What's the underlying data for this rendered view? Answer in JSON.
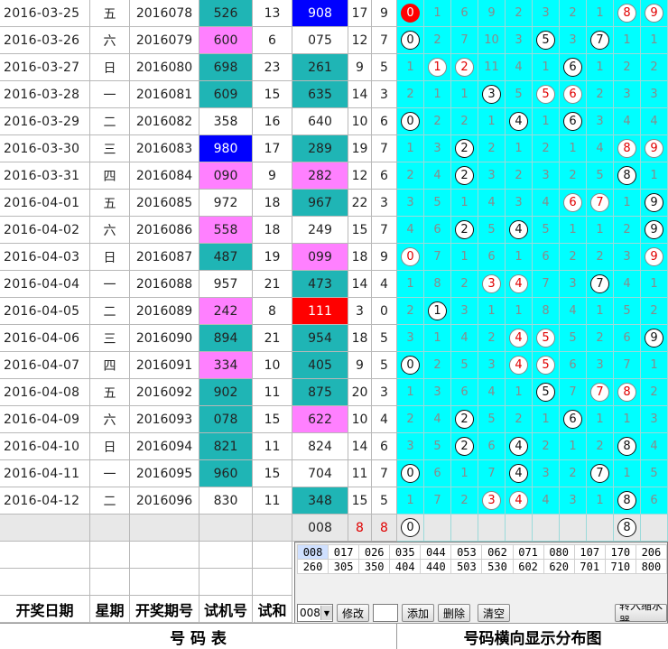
{
  "table": {
    "rows": [
      {
        "date": "2016-03-25",
        "week": "五",
        "issue": "2016078",
        "trial": "526",
        "trial_color": "teal",
        "sum1": "13",
        "draw": "908",
        "draw_color": "blue",
        "sum2": "17",
        "span": "9",
        "dist": [
          {
            "v": "0",
            "s": "fill"
          },
          {
            "v": "1"
          },
          {
            "v": "6"
          },
          {
            "v": "9"
          },
          {
            "v": "2"
          },
          {
            "v": "3"
          },
          {
            "v": "2"
          },
          {
            "v": "1"
          },
          {
            "v": "8",
            "s": "red"
          },
          {
            "v": "9",
            "s": "red"
          }
        ]
      },
      {
        "date": "2016-03-26",
        "week": "六",
        "issue": "2016079",
        "trial": "600",
        "trial_color": "pink",
        "sum1": "6",
        "draw": "075",
        "draw_color": "",
        "sum2": "12",
        "span": "7",
        "dist": [
          {
            "v": "0",
            "s": "c"
          },
          {
            "v": "2"
          },
          {
            "v": "7"
          },
          {
            "v": "10"
          },
          {
            "v": "3"
          },
          {
            "v": "5",
            "s": "c"
          },
          {
            "v": "3"
          },
          {
            "v": "7",
            "s": "c"
          },
          {
            "v": "1"
          },
          {
            "v": "1"
          }
        ]
      },
      {
        "date": "2016-03-27",
        "week": "日",
        "issue": "2016080",
        "trial": "698",
        "trial_color": "teal",
        "sum1": "23",
        "draw": "261",
        "draw_color": "teal",
        "sum2": "9",
        "span": "5",
        "dist": [
          {
            "v": "1"
          },
          {
            "v": "1",
            "s": "red"
          },
          {
            "v": "2",
            "s": "red"
          },
          {
            "v": "11"
          },
          {
            "v": "4"
          },
          {
            "v": "1"
          },
          {
            "v": "6",
            "s": "c"
          },
          {
            "v": "1"
          },
          {
            "v": "2"
          },
          {
            "v": "2"
          }
        ]
      },
      {
        "date": "2016-03-28",
        "week": "一",
        "issue": "2016081",
        "trial": "609",
        "trial_color": "teal",
        "sum1": "15",
        "draw": "635",
        "draw_color": "teal",
        "sum2": "14",
        "span": "3",
        "dist": [
          {
            "v": "2"
          },
          {
            "v": "1"
          },
          {
            "v": "1"
          },
          {
            "v": "3",
            "s": "c"
          },
          {
            "v": "5"
          },
          {
            "v": "5",
            "s": "red"
          },
          {
            "v": "6",
            "s": "red"
          },
          {
            "v": "2"
          },
          {
            "v": "3"
          },
          {
            "v": "3"
          }
        ]
      },
      {
        "date": "2016-03-29",
        "week": "二",
        "issue": "2016082",
        "trial": "358",
        "trial_color": "",
        "sum1": "16",
        "draw": "640",
        "draw_color": "",
        "sum2": "10",
        "span": "6",
        "dist": [
          {
            "v": "0",
            "s": "c"
          },
          {
            "v": "2"
          },
          {
            "v": "2"
          },
          {
            "v": "1"
          },
          {
            "v": "4",
            "s": "c"
          },
          {
            "v": "1"
          },
          {
            "v": "6",
            "s": "c"
          },
          {
            "v": "3"
          },
          {
            "v": "4"
          },
          {
            "v": "4"
          }
        ]
      },
      {
        "date": "2016-03-30",
        "week": "三",
        "issue": "2016083",
        "trial": "980",
        "trial_color": "blue",
        "sum1": "17",
        "draw": "289",
        "draw_color": "teal",
        "sum2": "19",
        "span": "7",
        "dist": [
          {
            "v": "1"
          },
          {
            "v": "3"
          },
          {
            "v": "2",
            "s": "c"
          },
          {
            "v": "2"
          },
          {
            "v": "1"
          },
          {
            "v": "2"
          },
          {
            "v": "1"
          },
          {
            "v": "4"
          },
          {
            "v": "8",
            "s": "red"
          },
          {
            "v": "9",
            "s": "red"
          }
        ]
      },
      {
        "date": "2016-03-31",
        "week": "四",
        "issue": "2016084",
        "trial": "090",
        "trial_color": "pink",
        "sum1": "9",
        "draw": "282",
        "draw_color": "pink",
        "sum2": "12",
        "span": "6",
        "dist": [
          {
            "v": "2"
          },
          {
            "v": "4"
          },
          {
            "v": "2",
            "s": "c"
          },
          {
            "v": "3"
          },
          {
            "v": "2"
          },
          {
            "v": "3"
          },
          {
            "v": "2"
          },
          {
            "v": "5"
          },
          {
            "v": "8",
            "s": "c"
          },
          {
            "v": "1"
          }
        ]
      },
      {
        "date": "2016-04-01",
        "week": "五",
        "issue": "2016085",
        "trial": "972",
        "trial_color": "",
        "sum1": "18",
        "draw": "967",
        "draw_color": "teal",
        "sum2": "22",
        "span": "3",
        "dist": [
          {
            "v": "3"
          },
          {
            "v": "5"
          },
          {
            "v": "1"
          },
          {
            "v": "4"
          },
          {
            "v": "3"
          },
          {
            "v": "4"
          },
          {
            "v": "6",
            "s": "red"
          },
          {
            "v": "7",
            "s": "red"
          },
          {
            "v": "1"
          },
          {
            "v": "9",
            "s": "c"
          }
        ]
      },
      {
        "date": "2016-04-02",
        "week": "六",
        "issue": "2016086",
        "trial": "558",
        "trial_color": "pink",
        "sum1": "18",
        "draw": "249",
        "draw_color": "",
        "sum2": "15",
        "span": "7",
        "dist": [
          {
            "v": "4"
          },
          {
            "v": "6"
          },
          {
            "v": "2",
            "s": "c"
          },
          {
            "v": "5"
          },
          {
            "v": "4",
            "s": "c"
          },
          {
            "v": "5"
          },
          {
            "v": "1"
          },
          {
            "v": "1"
          },
          {
            "v": "2"
          },
          {
            "v": "9",
            "s": "c"
          }
        ]
      },
      {
        "date": "2016-04-03",
        "week": "日",
        "issue": "2016087",
        "trial": "487",
        "trial_color": "teal",
        "sum1": "19",
        "draw": "099",
        "draw_color": "pink",
        "sum2": "18",
        "span": "9",
        "dist": [
          {
            "v": "0",
            "s": "red"
          },
          {
            "v": "7"
          },
          {
            "v": "1"
          },
          {
            "v": "6"
          },
          {
            "v": "1"
          },
          {
            "v": "6"
          },
          {
            "v": "2"
          },
          {
            "v": "2"
          },
          {
            "v": "3"
          },
          {
            "v": "9",
            "s": "red"
          }
        ]
      },
      {
        "date": "2016-04-04",
        "week": "一",
        "issue": "2016088",
        "trial": "957",
        "trial_color": "",
        "sum1": "21",
        "draw": "473",
        "draw_color": "teal",
        "sum2": "14",
        "span": "4",
        "dist": [
          {
            "v": "1"
          },
          {
            "v": "8"
          },
          {
            "v": "2"
          },
          {
            "v": "3",
            "s": "red"
          },
          {
            "v": "4",
            "s": "red"
          },
          {
            "v": "7"
          },
          {
            "v": "3"
          },
          {
            "v": "7",
            "s": "c"
          },
          {
            "v": "4"
          },
          {
            "v": "1"
          }
        ]
      },
      {
        "date": "2016-04-05",
        "week": "二",
        "issue": "2016089",
        "trial": "242",
        "trial_color": "pink",
        "sum1": "8",
        "draw": "111",
        "draw_color": "red",
        "sum2": "3",
        "span": "0",
        "dist": [
          {
            "v": "2"
          },
          {
            "v": "1",
            "s": "c"
          },
          {
            "v": "3"
          },
          {
            "v": "1"
          },
          {
            "v": "1"
          },
          {
            "v": "8"
          },
          {
            "v": "4"
          },
          {
            "v": "1"
          },
          {
            "v": "5"
          },
          {
            "v": "2"
          }
        ]
      },
      {
        "date": "2016-04-06",
        "week": "三",
        "issue": "2016090",
        "trial": "894",
        "trial_color": "teal",
        "sum1": "21",
        "draw": "954",
        "draw_color": "teal",
        "sum2": "18",
        "span": "5",
        "dist": [
          {
            "v": "3"
          },
          {
            "v": "1"
          },
          {
            "v": "4"
          },
          {
            "v": "2"
          },
          {
            "v": "4",
            "s": "red"
          },
          {
            "v": "5",
            "s": "red"
          },
          {
            "v": "5"
          },
          {
            "v": "2"
          },
          {
            "v": "6"
          },
          {
            "v": "9",
            "s": "c"
          }
        ]
      },
      {
        "date": "2016-04-07",
        "week": "四",
        "issue": "2016091",
        "trial": "334",
        "trial_color": "pink",
        "sum1": "10",
        "draw": "405",
        "draw_color": "teal",
        "sum2": "9",
        "span": "5",
        "dist": [
          {
            "v": "0",
            "s": "c"
          },
          {
            "v": "2"
          },
          {
            "v": "5"
          },
          {
            "v": "3"
          },
          {
            "v": "4",
            "s": "red"
          },
          {
            "v": "5",
            "s": "red"
          },
          {
            "v": "6"
          },
          {
            "v": "3"
          },
          {
            "v": "7"
          },
          {
            "v": "1"
          }
        ]
      },
      {
        "date": "2016-04-08",
        "week": "五",
        "issue": "2016092",
        "trial": "902",
        "trial_color": "teal",
        "sum1": "11",
        "draw": "875",
        "draw_color": "teal",
        "sum2": "20",
        "span": "3",
        "dist": [
          {
            "v": "1"
          },
          {
            "v": "3"
          },
          {
            "v": "6"
          },
          {
            "v": "4"
          },
          {
            "v": "1"
          },
          {
            "v": "5",
            "s": "c"
          },
          {
            "v": "7"
          },
          {
            "v": "7",
            "s": "red"
          },
          {
            "v": "8",
            "s": "red"
          },
          {
            "v": "2"
          }
        ]
      },
      {
        "date": "2016-04-09",
        "week": "六",
        "issue": "2016093",
        "trial": "078",
        "trial_color": "teal",
        "sum1": "15",
        "draw": "622",
        "draw_color": "pink",
        "sum2": "10",
        "span": "4",
        "dist": [
          {
            "v": "2"
          },
          {
            "v": "4"
          },
          {
            "v": "2",
            "s": "c"
          },
          {
            "v": "5"
          },
          {
            "v": "2"
          },
          {
            "v": "1"
          },
          {
            "v": "6",
            "s": "c"
          },
          {
            "v": "1"
          },
          {
            "v": "1"
          },
          {
            "v": "3"
          }
        ]
      },
      {
        "date": "2016-04-10",
        "week": "日",
        "issue": "2016094",
        "trial": "821",
        "trial_color": "teal",
        "sum1": "11",
        "draw": "824",
        "draw_color": "",
        "sum2": "14",
        "span": "6",
        "dist": [
          {
            "v": "3"
          },
          {
            "v": "5"
          },
          {
            "v": "2",
            "s": "c"
          },
          {
            "v": "6"
          },
          {
            "v": "4",
            "s": "c"
          },
          {
            "v": "2"
          },
          {
            "v": "1"
          },
          {
            "v": "2"
          },
          {
            "v": "8",
            "s": "c"
          },
          {
            "v": "4"
          }
        ]
      },
      {
        "date": "2016-04-11",
        "week": "一",
        "issue": "2016095",
        "trial": "960",
        "trial_color": "teal",
        "sum1": "15",
        "draw": "704",
        "draw_color": "",
        "sum2": "11",
        "span": "7",
        "dist": [
          {
            "v": "0",
            "s": "c"
          },
          {
            "v": "6"
          },
          {
            "v": "1"
          },
          {
            "v": "7"
          },
          {
            "v": "4",
            "s": "c"
          },
          {
            "v": "3"
          },
          {
            "v": "2"
          },
          {
            "v": "7",
            "s": "c"
          },
          {
            "v": "1"
          },
          {
            "v": "5"
          }
        ]
      },
      {
        "date": "2016-04-12",
        "week": "二",
        "issue": "2016096",
        "trial": "830",
        "trial_color": "",
        "sum1": "11",
        "draw": "348",
        "draw_color": "teal",
        "sum2": "15",
        "span": "5",
        "dist": [
          {
            "v": "1"
          },
          {
            "v": "7"
          },
          {
            "v": "2"
          },
          {
            "v": "3",
            "s": "red"
          },
          {
            "v": "4",
            "s": "red"
          },
          {
            "v": "4"
          },
          {
            "v": "3"
          },
          {
            "v": "1"
          },
          {
            "v": "8",
            "s": "c"
          },
          {
            "v": "6"
          }
        ]
      }
    ],
    "prediction": {
      "draw": "008",
      "sum2": "8",
      "span": "8",
      "dist": [
        {
          "v": "0",
          "s": "c"
        },
        {
          "v": ""
        },
        {
          "v": ""
        },
        {
          "v": ""
        },
        {
          "v": ""
        },
        {
          "v": ""
        },
        {
          "v": ""
        },
        {
          "v": ""
        },
        {
          "v": "8",
          "s": "c"
        },
        {
          "v": ""
        }
      ]
    },
    "headers": {
      "date": "开奖日期",
      "week": "星期",
      "issue": "开奖期号",
      "trial": "试机号",
      "sum": "试和"
    }
  },
  "panel": {
    "numbers_row1": [
      "008",
      "017",
      "026",
      "035",
      "044",
      "053",
      "062",
      "071",
      "080",
      "107",
      "170",
      "206"
    ],
    "numbers_row2": [
      "260",
      "305",
      "350",
      "404",
      "440",
      "503",
      "530",
      "602",
      "620",
      "701",
      "710",
      "800"
    ],
    "selected_value": "008",
    "buttons": {
      "modify": "修改",
      "add": "添加",
      "delete": "删除",
      "clear": "清空",
      "import": "转入缩水器"
    }
  },
  "footer": {
    "left": "号  码  表",
    "right": "号码横向显示分布图"
  },
  "colors": {
    "teal": "#1fb5b5",
    "pink": "#ff80ff",
    "blue": "#0000ff",
    "red": "#ff0000",
    "cyan": "#00ffff"
  }
}
